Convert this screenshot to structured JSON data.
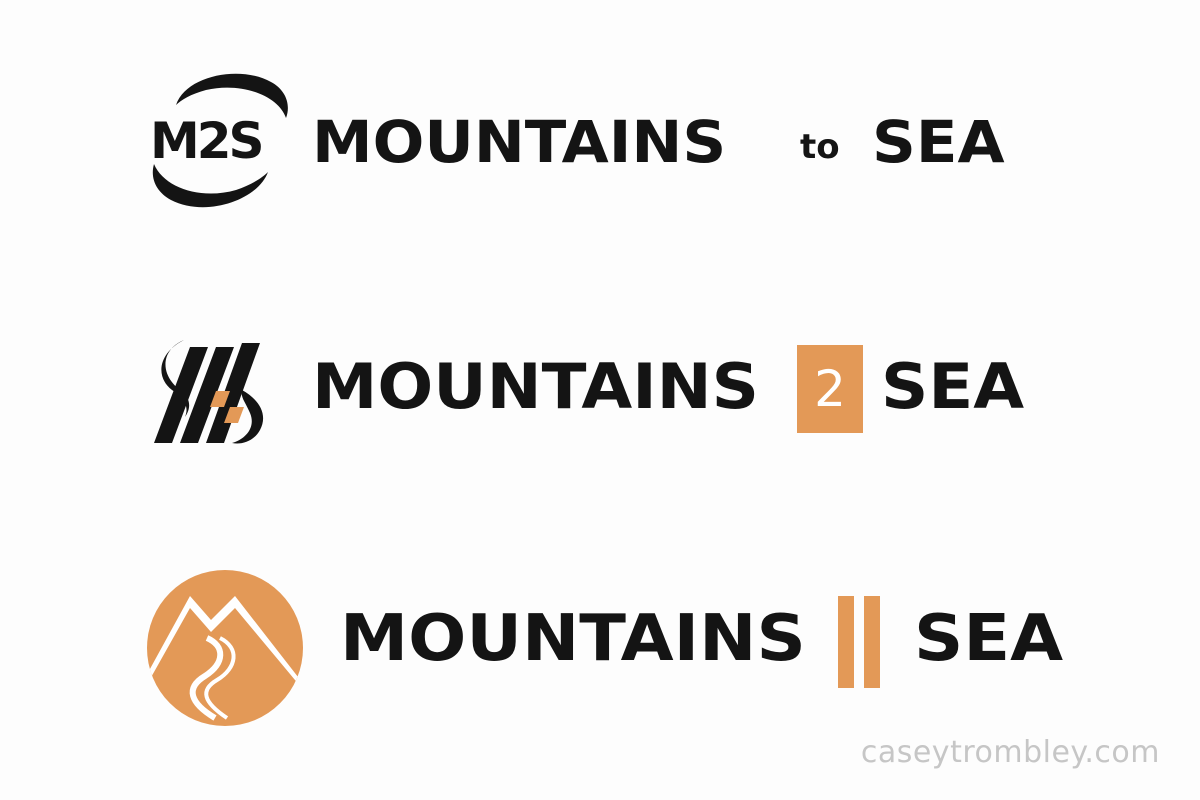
{
  "logo1": {
    "monogram": "M2S",
    "word_left": "MOUNTAINS",
    "word_mid": "to",
    "word_right": "SEA"
  },
  "logo2": {
    "word_left": "MOUNTAINS",
    "badge": "2",
    "word_right": "SEA"
  },
  "logo3": {
    "word_left": "MOUNTAINS",
    "word_right": "SEA"
  },
  "credit": "caseytrombley.com",
  "colors": {
    "ink": "#141414",
    "accent": "#e39957",
    "credit": "#c6c6c6",
    "background": "#fdfdfd"
  },
  "icons": {
    "logo1": "m2s-ring-emblem",
    "logo2": "striped-s-emblem",
    "logo3": "mountain-road-circle-emblem"
  }
}
